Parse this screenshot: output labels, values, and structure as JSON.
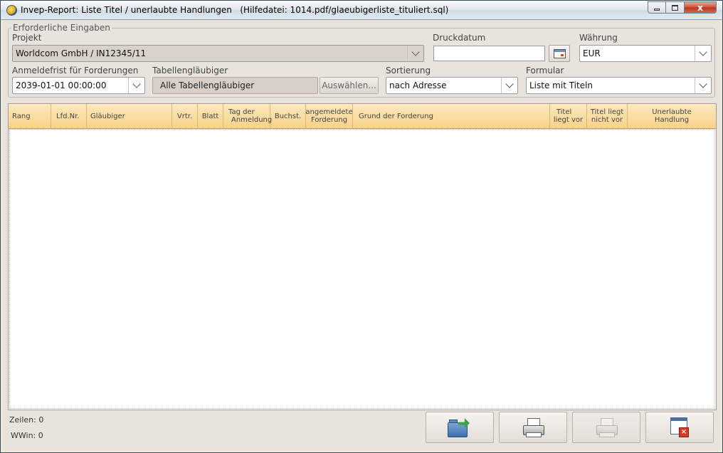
{
  "window": {
    "title": "Invep-Report: Liste Titel / unerlaubte Handlungen",
    "help_file": "(Hilfedatei: 1014.pdf/glaeubigerliste_tituliert.sql)",
    "close_glyph": "x"
  },
  "form": {
    "group_title": "Erforderliche Eingaben",
    "projekt": {
      "label": "Projekt",
      "value": "Worldcom GmbH / IN12345/11"
    },
    "druckdatum": {
      "label": "Druckdatum",
      "value": ""
    },
    "waehrung": {
      "label": "Währung",
      "value": "EUR"
    },
    "anmeldefrist": {
      "label": "Anmeldefrist für Forderungen",
      "value": "2039-01-01 00:00:00"
    },
    "tabellenglaeubiger": {
      "label": "Tabellengläubiger",
      "value": "Alle Tabellengläubiger",
      "button": "Auswählen..."
    },
    "sortierung": {
      "label": "Sortierung",
      "value": "nach Adresse"
    },
    "formular": {
      "label": "Formular",
      "value": "Liste mit Titeln"
    }
  },
  "table": {
    "columns": [
      {
        "l1": "Rang",
        "l2": ""
      },
      {
        "l1": "Lfd.Nr.",
        "l2": ""
      },
      {
        "l1": "Gläubiger",
        "l2": ""
      },
      {
        "l1": "Vrtr.",
        "l2": ""
      },
      {
        "l1": "Blatt",
        "l2": ""
      },
      {
        "l1": "Tag der",
        "l2": "Anmeldung"
      },
      {
        "l1": "Buchst.",
        "l2": ""
      },
      {
        "l1": "angemeldete",
        "l2": "Forderung"
      },
      {
        "l1": "Grund der Forderung",
        "l2": ""
      },
      {
        "l1": "Titel",
        "l2": "liegt vor"
      },
      {
        "l1": "Titel liegt",
        "l2": "nicht vor"
      },
      {
        "l1": "Unerlaubte",
        "l2": "Handlung"
      }
    ]
  },
  "status": {
    "zeilen": "Zeilen: 0",
    "wwin": "WWin: 0"
  },
  "icons": {
    "export": "folder-export-icon",
    "print": "printer-icon",
    "print_preview": "printer-preview-icon",
    "close": "close-window-icon"
  }
}
